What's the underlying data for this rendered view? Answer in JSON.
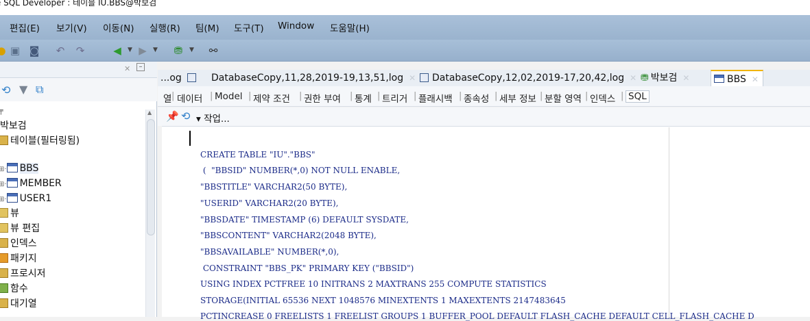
{
  "window": {
    "title": "cle SQL Developer : 테이블 IU.BBS@박보검"
  },
  "menu": [
    "편집(E)",
    "보기(V)",
    "이동(N)",
    "실행(R)",
    "팀(M)",
    "도구(T)",
    "Window",
    "도움말(H)"
  ],
  "tree": {
    "connection": "박보검",
    "items": [
      {
        "label": "테이블(필터링됨)",
        "icon": "table-folder-icon"
      },
      {
        "label": "BBS",
        "icon": "table-icon"
      },
      {
        "label": "MEMBER",
        "icon": "table-icon"
      },
      {
        "label": "USER1",
        "icon": "table-icon"
      },
      {
        "label": "뷰",
        "icon": "view-folder-icon"
      },
      {
        "label": "뷰 편집",
        "icon": "view-folder-icon"
      },
      {
        "label": "인덱스",
        "icon": "index-folder-icon"
      },
      {
        "label": "패키지",
        "icon": "package-folder-icon"
      },
      {
        "label": "프로시저",
        "icon": "procedure-folder-icon"
      },
      {
        "label": "함수",
        "icon": "function-folder-icon"
      },
      {
        "label": "대기열",
        "icon": "queue-folder-icon"
      }
    ]
  },
  "tabs": [
    {
      "label": "...og"
    },
    {
      "label": "DatabaseCopy,11,28,2019-19,13,51,log"
    },
    {
      "label": "DatabaseCopy,12,02,2019-17,20,42,log"
    },
    {
      "label": "박보검"
    },
    {
      "label": "BBS"
    }
  ],
  "subtabs": [
    "열",
    "데이터",
    "Model",
    "제약 조건",
    "권한 부여",
    "통계",
    "트리거",
    "플래시백",
    "종속성",
    "세부 정보",
    "분할 영역",
    "인덱스",
    "SQL"
  ],
  "actions": {
    "dropdown_label": "▾ 작업..."
  },
  "sql_lines": [
    "CREATE TABLE \"IU\".\"BBS\"",
    " (  \"BBSID\" NUMBER(*,0) NOT NULL ENABLE,",
    "\"BBSTITLE\" VARCHAR2(50 BYTE),",
    "\"USERID\" VARCHAR2(20 BYTE),",
    "\"BBSDATE\" TIMESTAMP (6) DEFAULT SYSDATE,",
    "\"BBSCONTENT\" VARCHAR2(2048 BYTE),",
    "\"BBSAVAILABLE\" NUMBER(*,0),",
    " CONSTRAINT \"BBS_PK\" PRIMARY KEY (\"BBSID\")",
    "USING INDEX PCTFREE 10 INITRANS 2 MAXTRANS 255 COMPUTE STATISTICS",
    "STORAGE(INITIAL 65536 NEXT 1048576 MINEXTENTS 1 MAXEXTENTS 2147483645",
    "PCTINCREASE 0 FREELISTS 1 FREELIST GROUPS 1 BUFFER_POOL DEFAULT FLASH_CACHE DEFAULT CELL_FLASH_CACHE D"
  ]
}
